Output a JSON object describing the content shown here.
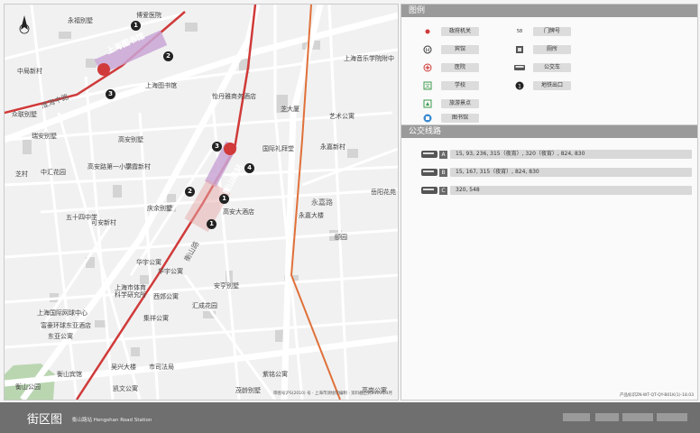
{
  "map": {
    "station_name": "上海图书馆",
    "station_name_2": "衡山路站",
    "line_label": "10号线",
    "labels": {
      "yongfu": "永福别墅",
      "bogai": "博爱医院",
      "zhongshan": "中局新村",
      "library": "上海图书馆",
      "zhongjing": "众联别墅",
      "wenzhai": "瑞安别墅",
      "yisheng": "怡丹雅商务酒店",
      "gaoan": "高安别墅",
      "gaoan_school": "高安路第一小学",
      "gaoxiao": "高霞新村",
      "zhiyun": "芝村",
      "zhonghui": "中汇花园",
      "wushisi": "五十四中学",
      "qingyu": "庆余别墅",
      "kean": "可安新村",
      "gaoan_hotel": "高安大酒店",
      "huamei": "华宇公寓",
      "huailong": "华宇公寓",
      "xijie": "西郊公寓",
      "anheng": "安亨别墅",
      "huicheng": "汇成花园",
      "sports": "上海市体育科学研究所",
      "jixiang": "集祥公寓",
      "intl_tennis": "上海国际网球中心",
      "fuhao": "富豪环球东亚酒店",
      "dongya": "东亚公寓",
      "hengshan_hotel": "衡山宾馆",
      "hengshan_park": "衡山公园",
      "wuxing": "吴兴大楼",
      "court": "市司法局",
      "kaiwen": "凯文公寓",
      "ziming": "紫铭公寓",
      "maoling": "茂龄别墅",
      "gaoan_apt": "高岗公寓",
      "yongjia": "永嘉大楼",
      "yongjia_xc": "永嘉新村",
      "yiyuan": "颐园",
      "yueyang": "岳阳花苑",
      "conservatory": "上海音乐学院附中",
      "yishu": "艺术公寓",
      "zhida": "芝大厦",
      "church": "国际礼拜堂",
      "meishu": "美丽园",
      "road_huaihai": "淮海中路",
      "road_hengshan": "衡山路",
      "road_yongjia": "永嘉路",
      "road_gaoan": "高安路"
    },
    "exits": [
      "1",
      "2",
      "3",
      "4",
      "1",
      "2",
      "3",
      "4"
    ],
    "footnote": "审图号沪S(2010)  号 · 上海市测绘院编制 · 资料截止到2010年3月"
  },
  "legend": {
    "title": "图例",
    "items": [
      {
        "label": "政府机关",
        "icon": "gov-icon"
      },
      {
        "label": "门牌号",
        "icon": "house-number-icon"
      },
      {
        "label": "宾馆",
        "icon": "hotel-icon"
      },
      {
        "label": "厕所",
        "icon": "toilet-icon"
      },
      {
        "label": "医院",
        "icon": "hospital-icon"
      },
      {
        "label": "公交车",
        "icon": "bus-icon"
      },
      {
        "label": "学校",
        "icon": "school-icon"
      },
      {
        "label": "地铁出口",
        "icon": "metro-exit-icon"
      },
      {
        "label": "旅游景点",
        "icon": "tourism-icon"
      },
      {
        "label": "图书馆",
        "icon": "library-icon"
      }
    ]
  },
  "routes": {
    "title": "公交线路",
    "items": [
      {
        "badge": "A",
        "text": "15, 93, 236, 315（夜宵）, 320（夜宵）, 824, 830"
      },
      {
        "badge": "B",
        "text": "15, 167, 315（夜宵）, 824, 830"
      },
      {
        "badge": "C",
        "text": "320, 548"
      }
    ],
    "footnote": "产品标识ZN-WT-QT-QY-B01K(1)-18.03"
  },
  "footer": {
    "title": "街区图",
    "station": "衡山路站  Hengshan Road Station"
  },
  "colors": {
    "metro": "#d03a3a",
    "road_major": "#ffffff",
    "building": "#cfcfcf",
    "park": "#b9d6b0",
    "station_box": "#c9a6d6"
  }
}
